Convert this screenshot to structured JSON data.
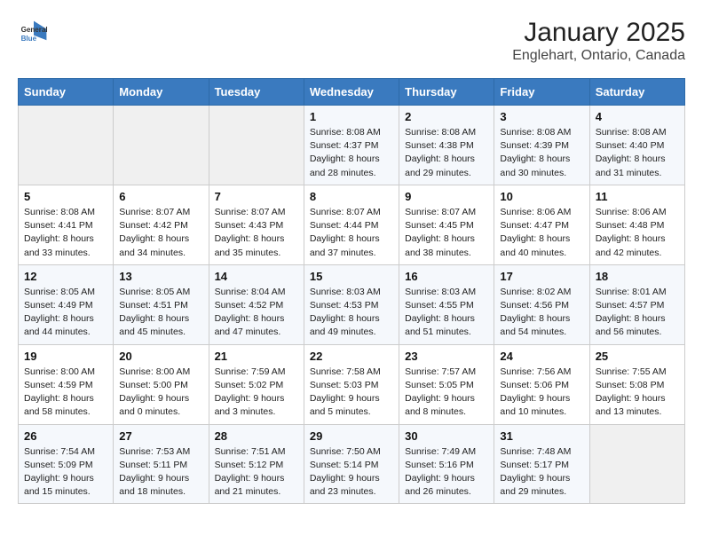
{
  "header": {
    "logo": {
      "general": "General",
      "blue": "Blue"
    },
    "title": "January 2025",
    "subtitle": "Englehart, Ontario, Canada"
  },
  "weekdays": [
    "Sunday",
    "Monday",
    "Tuesday",
    "Wednesday",
    "Thursday",
    "Friday",
    "Saturday"
  ],
  "weeks": [
    [
      {
        "day": "",
        "info": ""
      },
      {
        "day": "",
        "info": ""
      },
      {
        "day": "",
        "info": ""
      },
      {
        "day": "1",
        "info": "Sunrise: 8:08 AM\nSunset: 4:37 PM\nDaylight: 8 hours\nand 28 minutes."
      },
      {
        "day": "2",
        "info": "Sunrise: 8:08 AM\nSunset: 4:38 PM\nDaylight: 8 hours\nand 29 minutes."
      },
      {
        "day": "3",
        "info": "Sunrise: 8:08 AM\nSunset: 4:39 PM\nDaylight: 8 hours\nand 30 minutes."
      },
      {
        "day": "4",
        "info": "Sunrise: 8:08 AM\nSunset: 4:40 PM\nDaylight: 8 hours\nand 31 minutes."
      }
    ],
    [
      {
        "day": "5",
        "info": "Sunrise: 8:08 AM\nSunset: 4:41 PM\nDaylight: 8 hours\nand 33 minutes."
      },
      {
        "day": "6",
        "info": "Sunrise: 8:07 AM\nSunset: 4:42 PM\nDaylight: 8 hours\nand 34 minutes."
      },
      {
        "day": "7",
        "info": "Sunrise: 8:07 AM\nSunset: 4:43 PM\nDaylight: 8 hours\nand 35 minutes."
      },
      {
        "day": "8",
        "info": "Sunrise: 8:07 AM\nSunset: 4:44 PM\nDaylight: 8 hours\nand 37 minutes."
      },
      {
        "day": "9",
        "info": "Sunrise: 8:07 AM\nSunset: 4:45 PM\nDaylight: 8 hours\nand 38 minutes."
      },
      {
        "day": "10",
        "info": "Sunrise: 8:06 AM\nSunset: 4:47 PM\nDaylight: 8 hours\nand 40 minutes."
      },
      {
        "day": "11",
        "info": "Sunrise: 8:06 AM\nSunset: 4:48 PM\nDaylight: 8 hours\nand 42 minutes."
      }
    ],
    [
      {
        "day": "12",
        "info": "Sunrise: 8:05 AM\nSunset: 4:49 PM\nDaylight: 8 hours\nand 44 minutes."
      },
      {
        "day": "13",
        "info": "Sunrise: 8:05 AM\nSunset: 4:51 PM\nDaylight: 8 hours\nand 45 minutes."
      },
      {
        "day": "14",
        "info": "Sunrise: 8:04 AM\nSunset: 4:52 PM\nDaylight: 8 hours\nand 47 minutes."
      },
      {
        "day": "15",
        "info": "Sunrise: 8:03 AM\nSunset: 4:53 PM\nDaylight: 8 hours\nand 49 minutes."
      },
      {
        "day": "16",
        "info": "Sunrise: 8:03 AM\nSunset: 4:55 PM\nDaylight: 8 hours\nand 51 minutes."
      },
      {
        "day": "17",
        "info": "Sunrise: 8:02 AM\nSunset: 4:56 PM\nDaylight: 8 hours\nand 54 minutes."
      },
      {
        "day": "18",
        "info": "Sunrise: 8:01 AM\nSunset: 4:57 PM\nDaylight: 8 hours\nand 56 minutes."
      }
    ],
    [
      {
        "day": "19",
        "info": "Sunrise: 8:00 AM\nSunset: 4:59 PM\nDaylight: 8 hours\nand 58 minutes."
      },
      {
        "day": "20",
        "info": "Sunrise: 8:00 AM\nSunset: 5:00 PM\nDaylight: 9 hours\nand 0 minutes."
      },
      {
        "day": "21",
        "info": "Sunrise: 7:59 AM\nSunset: 5:02 PM\nDaylight: 9 hours\nand 3 minutes."
      },
      {
        "day": "22",
        "info": "Sunrise: 7:58 AM\nSunset: 5:03 PM\nDaylight: 9 hours\nand 5 minutes."
      },
      {
        "day": "23",
        "info": "Sunrise: 7:57 AM\nSunset: 5:05 PM\nDaylight: 9 hours\nand 8 minutes."
      },
      {
        "day": "24",
        "info": "Sunrise: 7:56 AM\nSunset: 5:06 PM\nDaylight: 9 hours\nand 10 minutes."
      },
      {
        "day": "25",
        "info": "Sunrise: 7:55 AM\nSunset: 5:08 PM\nDaylight: 9 hours\nand 13 minutes."
      }
    ],
    [
      {
        "day": "26",
        "info": "Sunrise: 7:54 AM\nSunset: 5:09 PM\nDaylight: 9 hours\nand 15 minutes."
      },
      {
        "day": "27",
        "info": "Sunrise: 7:53 AM\nSunset: 5:11 PM\nDaylight: 9 hours\nand 18 minutes."
      },
      {
        "day": "28",
        "info": "Sunrise: 7:51 AM\nSunset: 5:12 PM\nDaylight: 9 hours\nand 21 minutes."
      },
      {
        "day": "29",
        "info": "Sunrise: 7:50 AM\nSunset: 5:14 PM\nDaylight: 9 hours\nand 23 minutes."
      },
      {
        "day": "30",
        "info": "Sunrise: 7:49 AM\nSunset: 5:16 PM\nDaylight: 9 hours\nand 26 minutes."
      },
      {
        "day": "31",
        "info": "Sunrise: 7:48 AM\nSunset: 5:17 PM\nDaylight: 9 hours\nand 29 minutes."
      },
      {
        "day": "",
        "info": ""
      }
    ]
  ]
}
